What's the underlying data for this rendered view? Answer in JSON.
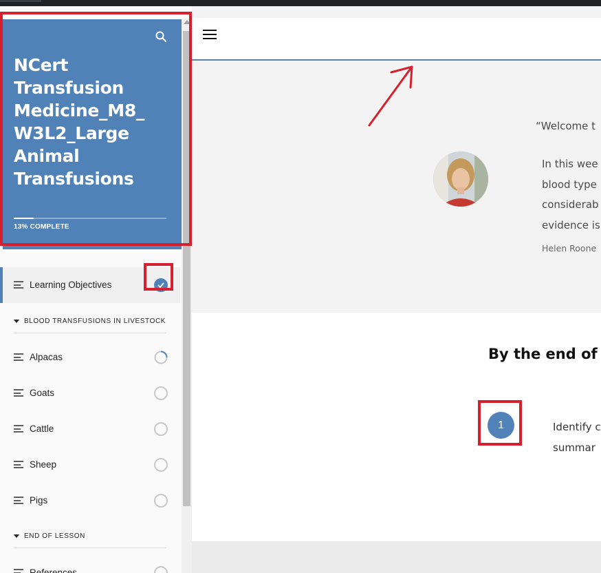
{
  "course": {
    "title": "NCert Transfusion Medicine_M8_ W3L2_Large Animal Transfusions",
    "title_lines": [
      "NCert",
      "Transfusion",
      "Medicine_M8_",
      "W3L2_Large",
      "Animal",
      "Transfusions"
    ],
    "progress_percent": 13,
    "progress_label": "13% COMPLETE"
  },
  "sidebar": {
    "active_lesson": {
      "label": "Learning Objectives",
      "status": "complete"
    },
    "sections": [
      {
        "title": "BLOOD TRANSFUSIONS IN LIVESTOCK",
        "lessons": [
          {
            "label": "Alpacas",
            "status": "in-progress"
          },
          {
            "label": "Goats",
            "status": "not-started"
          },
          {
            "label": "Cattle",
            "status": "not-started"
          },
          {
            "label": "Sheep",
            "status": "not-started"
          },
          {
            "label": "Pigs",
            "status": "not-started"
          }
        ]
      },
      {
        "title": "END OF LESSON",
        "lessons": [
          {
            "label": "References",
            "status": "not-started"
          }
        ]
      }
    ]
  },
  "main": {
    "quote": {
      "opening": "“Welcome t",
      "body_lines": [
        "In this wee",
        "blood type",
        "considerab",
        "evidence is"
      ],
      "author": "Helen Roone"
    },
    "objectives": {
      "heading": "By the end of",
      "items": [
        {
          "number": "1",
          "text_lines": [
            "Identify c",
            "summar"
          ]
        }
      ]
    }
  },
  "colors": {
    "accent": "#5082b8",
    "annotation": "#d6202f"
  },
  "icons": {
    "search": "search-icon",
    "menu": "hamburger-menu-icon",
    "check": "check-icon"
  }
}
